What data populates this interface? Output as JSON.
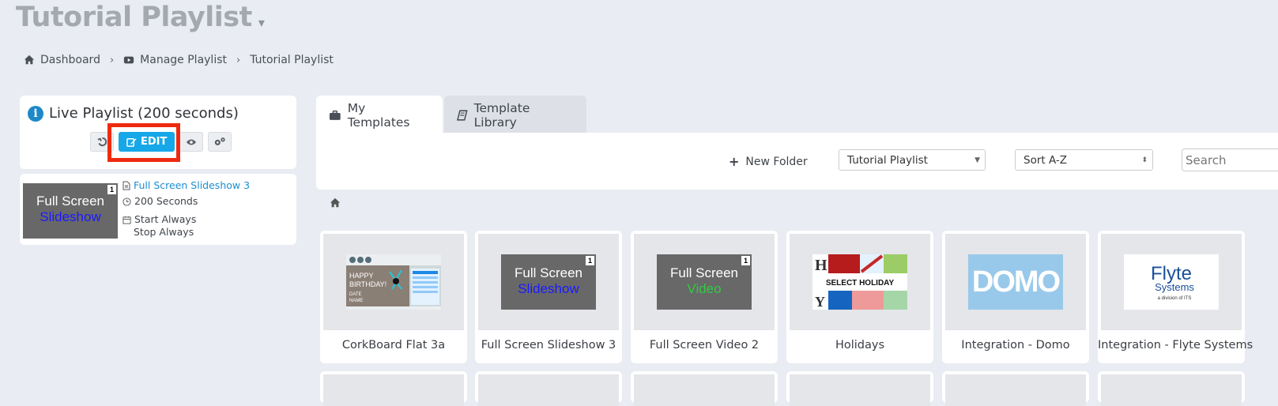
{
  "header": {
    "title": "Tutorial Playlist"
  },
  "breadcrumb": {
    "items": [
      {
        "label": "Dashboard",
        "icon": "home-icon"
      },
      {
        "label": "Manage Playlist",
        "icon": "youtube-icon"
      },
      {
        "label": "Tutorial Playlist",
        "icon": ""
      }
    ],
    "separator": "›"
  },
  "live_playlist": {
    "title": "Live Playlist (200 seconds)",
    "edit_label": "EDIT",
    "item": {
      "name": "Full Screen Slideshow 3",
      "duration": "200 Seconds",
      "start": "Start Always",
      "stop": "Stop Always",
      "thumb_line1": "Full Screen",
      "thumb_line2": "Slideshow",
      "badge": "1"
    }
  },
  "tabs": [
    {
      "label": "My Templates",
      "active": true
    },
    {
      "label": "Template Library",
      "active": false
    }
  ],
  "toolbar": {
    "new_folder_label": "New Folder",
    "folder_select": "Tutorial Playlist",
    "sort_select": "Sort A-Z",
    "search_placeholder": "Search"
  },
  "templates": [
    {
      "name": "CorkBoard Flat 3a",
      "thumb": "birthday",
      "texts": [
        "HAPPY",
        "BIRTHDAY!",
        "DATE",
        "NAME"
      ]
    },
    {
      "name": "Full Screen Slideshow 3",
      "thumb": "slideshow",
      "line1": "Full Screen",
      "line2": "Slideshow",
      "badge": "1"
    },
    {
      "name": "Full Screen Video 2",
      "thumb": "video",
      "line1": "Full Screen",
      "line2": "Video",
      "badge": "1"
    },
    {
      "name": "Holidays",
      "thumb": "holiday",
      "label": "SELECT HOLIDAY"
    },
    {
      "name": "Integration - Domo",
      "thumb": "domo",
      "logo": "DOMO"
    },
    {
      "name": "Integration - Flyte Systems",
      "thumb": "flyte",
      "logo1": "Flyte",
      "logo2": "Systems",
      "logo3": "a division of ITS"
    }
  ],
  "colors": {
    "accent": "#16a7e8",
    "highlight": "#ee2a10",
    "link": "#1b8fd2",
    "slideshow_text": "#1a1aff",
    "video_text": "#2ecc40",
    "domo_bg": "#99c9ea"
  }
}
